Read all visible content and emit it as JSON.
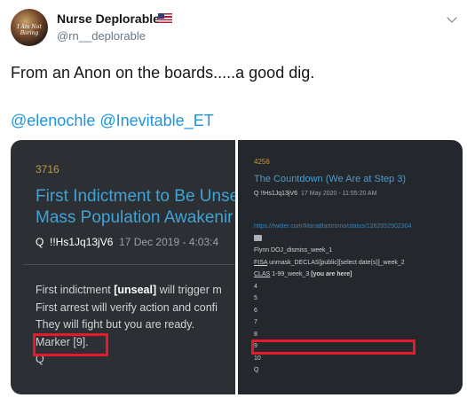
{
  "author": {
    "name": "Nurse Deplorable",
    "handle": "@rn__deplorable",
    "avatar_text": "I Am Not Boring"
  },
  "tweet": {
    "text": "From an Anon on the boards.....a good dig.",
    "mentions": [
      "@elenochle",
      "@Inevitable_ET"
    ]
  },
  "left_post": {
    "number": "3716",
    "title_line1": "First Indictment to Be Unse",
    "title_line2": "Mass Population Awakenir",
    "q": "Q",
    "trip": "!!Hs1Jq13jV6",
    "date": "17 Dec 2019 - 4:03:4",
    "body": {
      "line1_pre": "First indictment ",
      "line1_bold": "[unseal]",
      "line1_post": " will trigger m",
      "line2": "First arrest will verify action and confi",
      "line3": "They will fight but you are ready.",
      "line4": "Marker [9].",
      "line5": "Q"
    }
  },
  "right_post": {
    "number": "4256",
    "title": "The Countdown (We Are at Step 3)",
    "q": "Q",
    "trip": "!!Hs1Jq13jV6",
    "date": "17 May 2020 - 11:55:20 AM",
    "url": "https://twitter.com/MariaBartiromo/status/1262052902304",
    "line_flynn": "Flynn DOJ_dismiss_week_1",
    "line_fisa_pre": "FISA",
    "line_fisa_mid": " unmask_DECLAS",
    "line_fisa_post": "[public][select date(s)]_week_2",
    "line_clas_pre": "CLAS",
    "line_clas_mid": " 1-99_week_3 ",
    "line_clas_post": "[you are here]",
    "steps": [
      "4",
      "5",
      "6",
      "7",
      "8",
      "9",
      "10"
    ],
    "sign": "Q"
  },
  "colors": {
    "marker_box": "#e8192c",
    "link": "#1b95e0",
    "post_title": "#3fa3d6"
  }
}
